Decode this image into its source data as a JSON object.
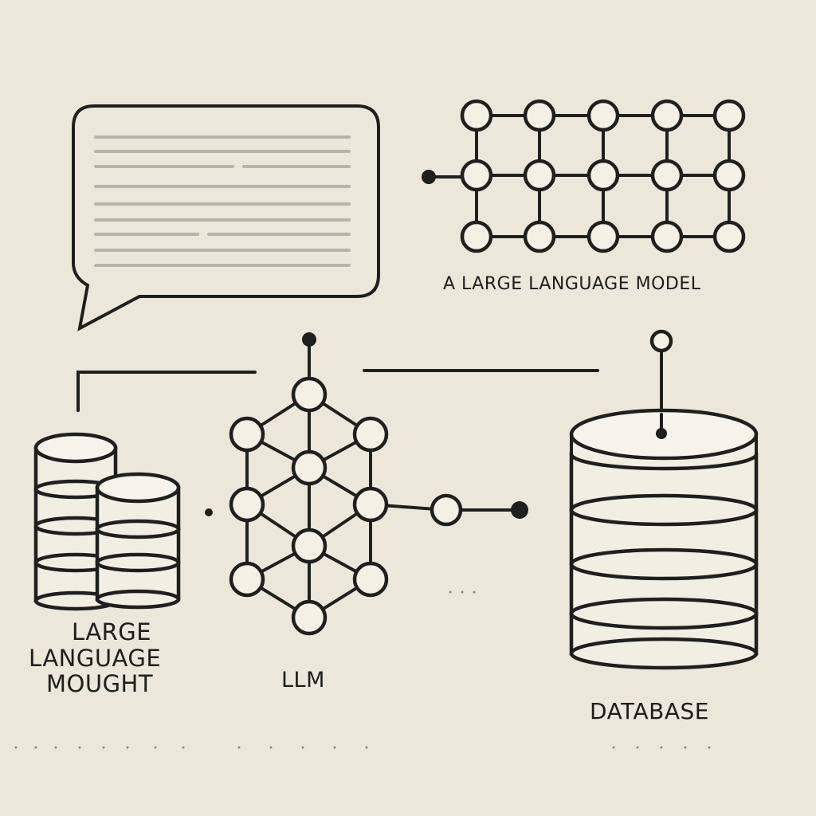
{
  "labels": {
    "llm_top": "A LARGE LANGUAGE MODEL",
    "left_line1": "LARGE",
    "left_line2": "LANGUAGE",
    "left_line3": "MOUGHT",
    "center": "LLM",
    "database": "DATABASE"
  },
  "icons": {
    "speech_bubble": "speech-bubble-icon",
    "neural_grid": "neural-network-grid-icon",
    "graph": "graph-network-icon",
    "small_databases": "database-stack-icon",
    "large_database": "database-icon"
  },
  "colors": {
    "background": "#ede7da",
    "stroke": "#1f1f1f",
    "node_fill": "#f5f0e4"
  }
}
